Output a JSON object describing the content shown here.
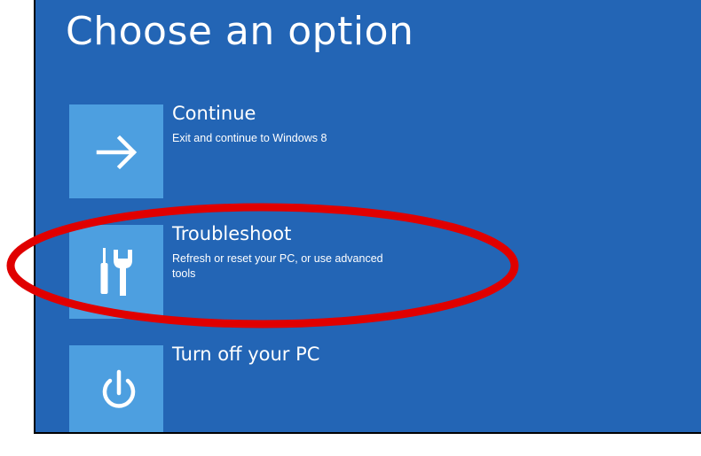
{
  "screen": {
    "title": "Choose an option",
    "background_color": "#2365b5",
    "tile_color": "#4d9fe0"
  },
  "options": [
    {
      "title": "Continue",
      "description": "Exit and continue to Windows 8",
      "icon": "arrow-right-icon"
    },
    {
      "title": "Troubleshoot",
      "description": "Refresh or reset your PC, or use advanced tools",
      "icon": "tools-icon"
    },
    {
      "title": "Turn off your PC",
      "description": "",
      "icon": "power-icon"
    }
  ],
  "annotation": {
    "shape": "ellipse",
    "color": "#e00000",
    "highlights": "Troubleshoot"
  }
}
